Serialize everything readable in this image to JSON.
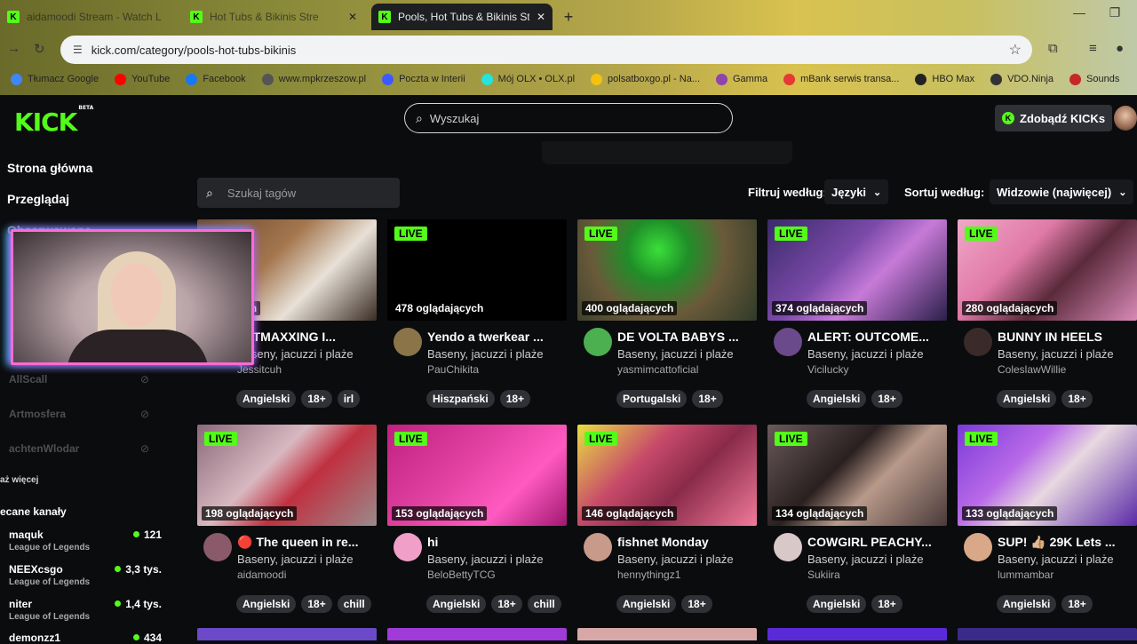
{
  "browser": {
    "tabs": [
      {
        "label": "aidamoodi Stream - Watch L",
        "active": false
      },
      {
        "label": "Hot Tubs & Bikinis Stre",
        "active": false
      },
      {
        "label": "Pools, Hot Tubs & Bikinis Strea",
        "active": true
      }
    ],
    "url": "kick.com/category/pools-hot-tubs-bikinis",
    "bookmarks": [
      {
        "label": "Tłumacz Google",
        "color": "#4285f4"
      },
      {
        "label": "YouTube",
        "color": "#ff0000"
      },
      {
        "label": "Facebook",
        "color": "#1877f2"
      },
      {
        "label": "www.mpkrzeszow.pl",
        "color": "#555555"
      },
      {
        "label": "Poczta w Interii",
        "color": "#3d5afe"
      },
      {
        "label": "Mój OLX • OLX.pl",
        "color": "#23e5db"
      },
      {
        "label": "polsatboxgo.pl - Na...",
        "color": "#f4c20d"
      },
      {
        "label": "Gamma",
        "color": "#8e44ad"
      },
      {
        "label": "mBank serwis transa...",
        "color": "#e53935"
      },
      {
        "label": "HBO Max",
        "color": "#222222"
      },
      {
        "label": "VDO.Ninja",
        "color": "#333333"
      },
      {
        "label": "Sounds",
        "color": "#c62828"
      }
    ]
  },
  "site": {
    "logo": "KICK",
    "logo_beta": "BETA",
    "search_placeholder": "Wyszukaj",
    "kicks_button": "Zdobądź KICKs",
    "accent": "#53fc18"
  },
  "sidebar": {
    "home": "Strona główna",
    "browse": "Przeglądaj",
    "followed_partial": "Obserwowane",
    "followed_channels": [
      "AllScall",
      "Artmosfera",
      "achtenWlodar"
    ],
    "show_more": "aż więcej",
    "recommended_head": "ecane kanały",
    "recommended": [
      {
        "name": "maquk",
        "game": "League of Legends",
        "count": "121"
      },
      {
        "name": "NEEXcsgo",
        "game": "League of Legends",
        "count": "3,3 tys."
      },
      {
        "name": "niter",
        "game": "League of Legends",
        "count": "1,4 tys."
      },
      {
        "name": "demonzz1",
        "game": "",
        "count": "434"
      }
    ]
  },
  "filters": {
    "tag_search_placeholder": "Szukaj tagów",
    "filter_label": "Filtruj według:",
    "languages": "Języki",
    "sort_label": "Sortuj według:",
    "sort_value": "Widzowie (najwięcej)"
  },
  "streams": [
    {
      "live": "",
      "viewers": "ądających",
      "title": "ATTMAXXING I...",
      "category": "Baseny, jacuzzi i plaże",
      "channel": "Jessitcuh",
      "tags": [
        "Angielski",
        "18+",
        "irl"
      ],
      "thumb": "linear-gradient(135deg,#6b4a2f 0%,#a3764e 40%,#e8e1d8 65%,#3a2c24 100%)",
      "avatar": "#7a5a48"
    },
    {
      "live": "LIVE",
      "viewers": "478 oglądających",
      "title": "Yendo a twerkear ...",
      "category": "Baseny, jacuzzi i plaże",
      "channel": "PauChikita",
      "tags": [
        "Hiszpański",
        "18+"
      ],
      "thumb": "#000000",
      "avatar": "#8a7448"
    },
    {
      "live": "LIVE",
      "viewers": "400 oglądających",
      "title": "DE VOLTA BABYS ...",
      "category": "Baseny, jacuzzi i plaże",
      "channel": "yasmimcattoficial",
      "tags": [
        "Portugalski",
        "18+"
      ],
      "thumb": "radial-gradient(circle at 45% 30%,#3adf3a 0%,#1f8f28 25%,#6a5a3a 55%,#2e3a28 100%)",
      "avatar": "#4caf50"
    },
    {
      "live": "LIVE",
      "viewers": "374 oglądających",
      "title": "ALERT: OUTCOME...",
      "category": "Baseny, jacuzzi i plaże",
      "channel": "Vicilucky",
      "tags": [
        "Angielski",
        "18+"
      ],
      "thumb": "linear-gradient(135deg,#3a2a6a 0%,#7a4aa8 40%,#c77ad8 60%,#2a1f4a 100%)",
      "avatar": "#6a4a8a"
    },
    {
      "live": "LIVE",
      "viewers": "280 oglądających",
      "title": "BUNNY IN HEELS",
      "category": "Baseny, jacuzzi i plaże",
      "channel": "ColeslawWillie",
      "tags": [
        "Angielski",
        "18+"
      ],
      "thumb": "linear-gradient(135deg,#f0a8c8 0%,#e07aa8 35%,#5a2a3a 60%,#d88ab8 100%)",
      "avatar": "#3a2a2a"
    },
    {
      "live": "LIVE",
      "viewers": "198 oglądających",
      "title": "🔴 The queen in re...",
      "category": "Baseny, jacuzzi i plaże",
      "channel": "aidamoodi",
      "tags": [
        "Angielski",
        "18+",
        "chill"
      ],
      "thumb": "linear-gradient(135deg,#8a6a7a 0%,#d8b8c0 40%,#c03040 60%,#9a8a8a 100%)",
      "avatar": "#8a5a6a"
    },
    {
      "live": "LIVE",
      "viewers": "153 oglądających",
      "title": "hi",
      "category": "Baseny, jacuzzi i plaże",
      "channel": "BeloBettyTCG",
      "tags": [
        "Angielski",
        "18+",
        "chill"
      ],
      "thumb": "linear-gradient(135deg,#c02080 0%,#e040a0 40%,#ff5ac0 70%,#a01870 100%)",
      "avatar": "#f0a0c8"
    },
    {
      "live": "LIVE",
      "viewers": "146 oglądających",
      "title": "fishnet Monday",
      "category": "Baseny, jacuzzi i plaże",
      "channel": "hennythingz1",
      "tags": [
        "Angielski",
        "18+"
      ],
      "thumb": "linear-gradient(135deg,#e8e040 0%,#c84a6a 35%,#8a2a4a 60%,#f07a9a 100%)",
      "avatar": "#c89a8a"
    },
    {
      "live": "LIVE",
      "viewers": "134 oglądających",
      "title": "COWGIRL PEACHY...",
      "category": "Baseny, jacuzzi i plaże",
      "channel": "Sukiira",
      "tags": [
        "Angielski",
        "18+"
      ],
      "thumb": "linear-gradient(135deg,#6a5a5a 0%,#2a2020 40%,#b89a8a 60%,#4a3a3a 100%)",
      "avatar": "#d8c8c8"
    },
    {
      "live": "LIVE",
      "viewers": "133 oglądających",
      "title": "SUP! 👍🏼 29K Lets ...",
      "category": "Baseny, jacuzzi i plaże",
      "channel": "lummambar",
      "tags": [
        "Angielski",
        "18+"
      ],
      "thumb": "linear-gradient(135deg,#7a3ad8 0%,#b86ae8 35%,#e8d8e0 55%,#5a2aa8 100%)",
      "avatar": "#d8a888"
    }
  ]
}
